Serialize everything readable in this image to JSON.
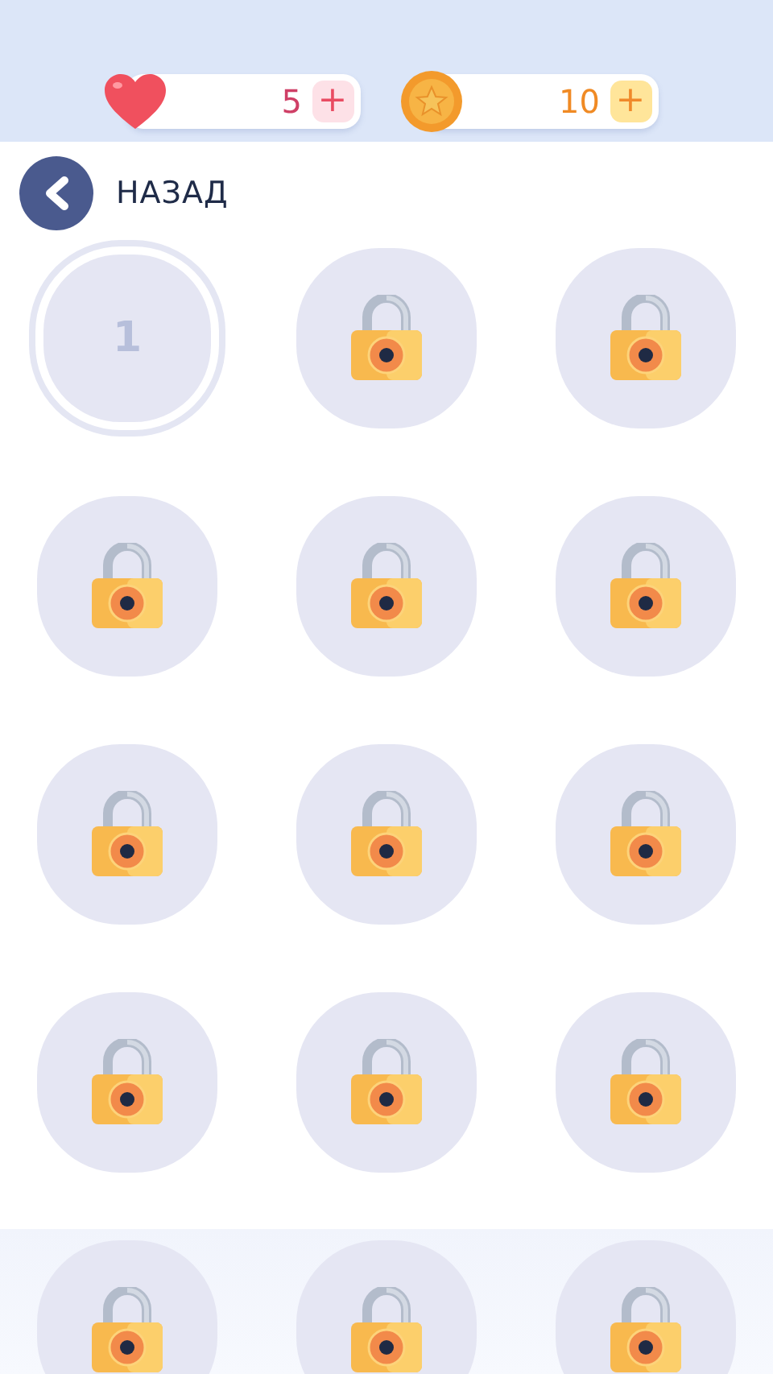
{
  "resources": [
    {
      "kind": "lives",
      "value": "5",
      "add": "+"
    },
    {
      "kind": "coins",
      "value": "10",
      "add": "+"
    }
  ],
  "back": {
    "label": "НАЗАД"
  },
  "levels": [
    {
      "label": "1",
      "locked": false,
      "selected": true
    },
    {
      "locked": true,
      "selected": false
    },
    {
      "locked": true,
      "selected": false
    },
    {
      "locked": true,
      "selected": false
    },
    {
      "locked": true,
      "selected": false
    },
    {
      "locked": true,
      "selected": false
    },
    {
      "locked": true,
      "selected": false
    },
    {
      "locked": true,
      "selected": false
    },
    {
      "locked": true,
      "selected": false
    },
    {
      "locked": true,
      "selected": false
    },
    {
      "locked": true,
      "selected": false
    },
    {
      "locked": true,
      "selected": false
    },
    {
      "locked": true,
      "selected": false
    },
    {
      "locked": true,
      "selected": false
    },
    {
      "locked": true,
      "selected": false
    }
  ]
}
